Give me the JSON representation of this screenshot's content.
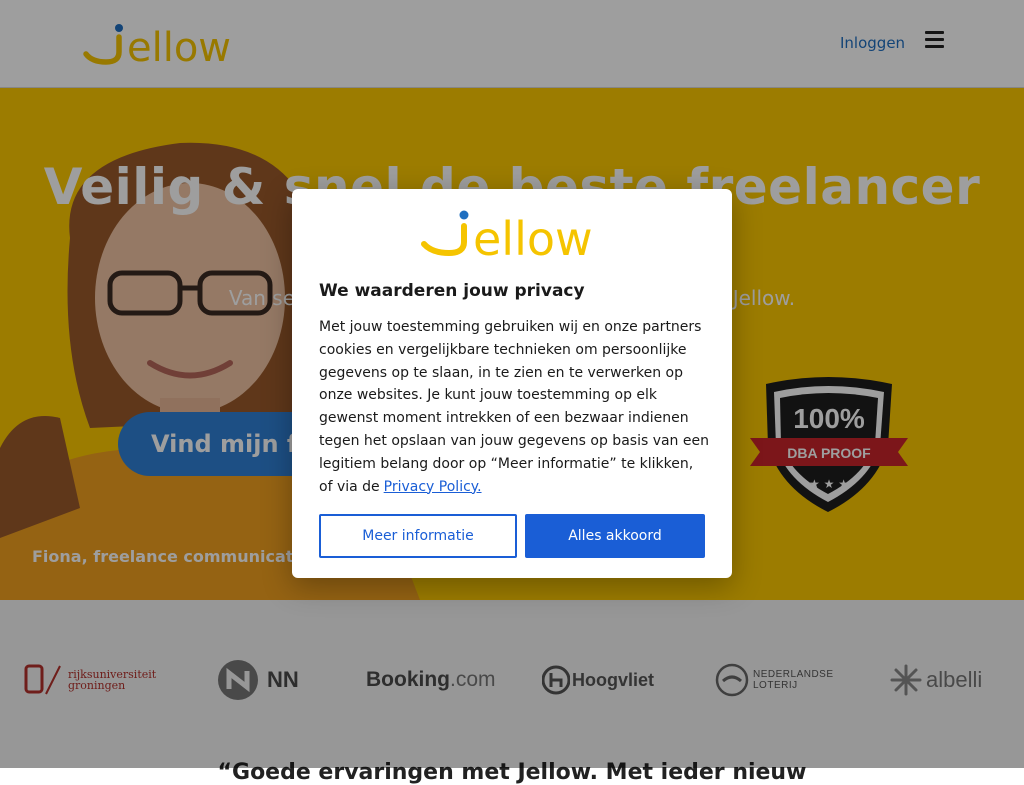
{
  "header": {
    "logo_text": "Jellow",
    "login_label": "Inloggen",
    "menu_icon": "hamburger-menu-icon"
  },
  "hero": {
    "title": "Veilig & snel de beste freelancer",
    "subtitle": "Van secretaresse tot freelancer ... 100% veilig via Jellow.",
    "cta_label": "Vind mijn freelancer",
    "caption": "Fiona, freelance communicatie-",
    "badge_percent": "100%",
    "badge_ribbon": "DBA PROOF",
    "background_color": "#fcc800"
  },
  "partners": {
    "rug_line1": "rijksuniversiteit",
    "rug_line2": "groningen",
    "nn": "NN",
    "booking_main": "Booking",
    "booking_suffix": ".com",
    "hoogvliet": "Hoogvliet",
    "loterij_line1": "NEDERLANDSE",
    "loterij_line2": "LOTERIJ",
    "albelli": "albelli"
  },
  "quote_peek": "“Goede ervaringen met Jellow. Met ieder nieuw",
  "consent": {
    "title": "We waarderen jouw privacy",
    "body": "Met jouw toestemming gebruiken wij en onze partners cookies en vergelijkbare technieken om persoonlijke gegevens op te slaan, in te zien en te verwerken op onze websites. Je kunt jouw toestemming op elk gewenst moment intrekken of een bezwaar indienen tegen het opslaan van jouw gegevens op basis van een legitiem belang door op “Meer informatie” te klikken, of via de",
    "policy_link": "Privacy Policy.",
    "more_info_label": "Meer informatie",
    "accept_label": "Alles akkoord",
    "accent_color": "#1a5ed6"
  }
}
